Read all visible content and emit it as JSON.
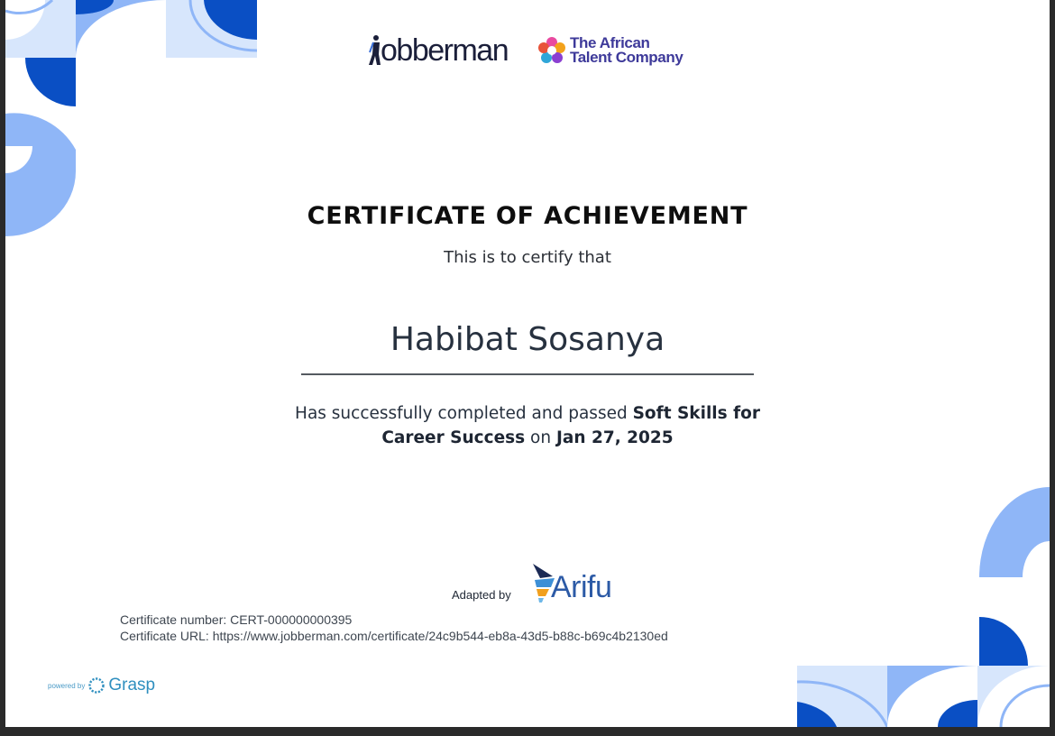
{
  "header": {
    "brand_left": "Jobberman",
    "brand_left_wordmark": "obberman",
    "brand_right_line1": "The African",
    "brand_right_line2": "Talent Company"
  },
  "certificate": {
    "title": "CERTIFICATE OF ACHIEVEMENT",
    "intro": "This is to certify that",
    "recipient": "Habibat Sosanya",
    "completion_prefix": "Has successfully completed and passed",
    "course": "Soft Skills for Career Success",
    "on_word": "on",
    "date": "Jan 27, 2025"
  },
  "adapted": {
    "label": "Adapted by",
    "brand": "Arifu"
  },
  "meta": {
    "number_line": "Certificate number: CERT-000000000395",
    "url_line": "Certificate URL: https://www.jobberman.com/certificate/24c9b544-eb8a-43d5-b88c-b69c4b2130ed"
  },
  "footer": {
    "powered_by": "powered by",
    "grasp": "Grasp"
  },
  "colors": {
    "deco_dark": "#0a4fc4",
    "deco_mid": "#8fb6f7",
    "deco_light": "#d7e6fc",
    "jobberman_text": "#1b1f3a",
    "atc_text": "#3e3a9a",
    "arifu_blue": "#2c5aa6"
  },
  "icons": {
    "jobberman_logo": "jobberman-figure-icon",
    "atc_logo": "flower-icon",
    "arifu_logo": "arifu-mark-icon",
    "grasp_logo": "grasp-ring-icon"
  }
}
